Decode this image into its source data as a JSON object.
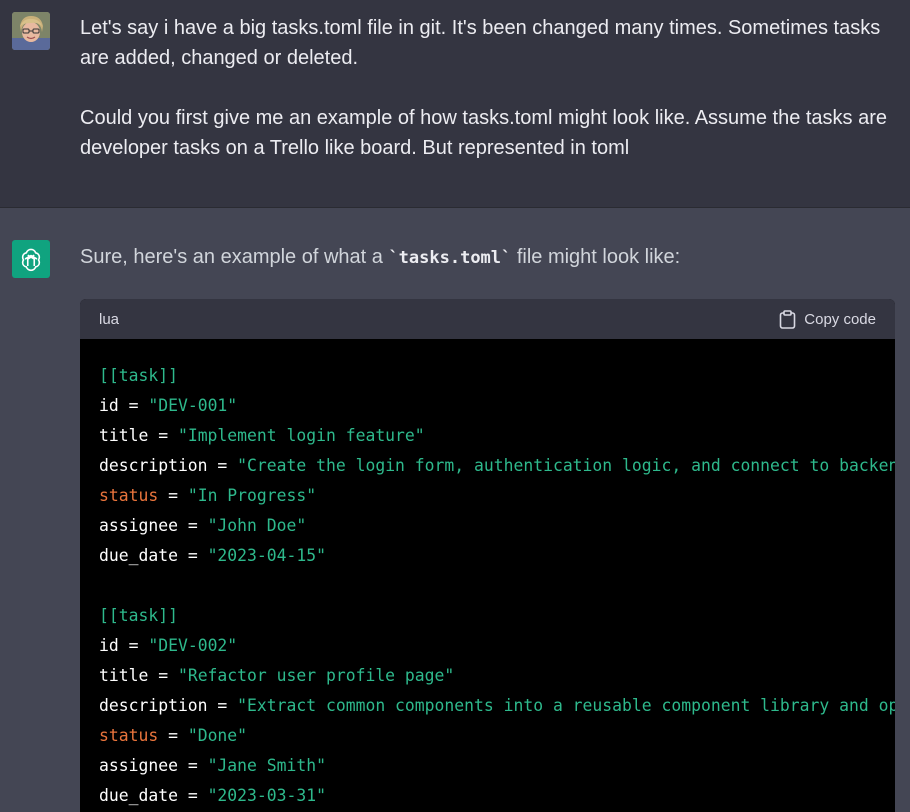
{
  "user_message": {
    "paragraph_1": "Let's say i have a big tasks.toml file in git. It's been changed many times. Sometimes tasks are added, changed or deleted.",
    "paragraph_2": "Could you first give me an example of how tasks.toml might look like. Assume the tasks are developer tasks on a Trello like board. But represented in toml"
  },
  "assistant_message": {
    "intro_before": "Sure, here's an example of what a ",
    "intro_code": "`tasks.toml`",
    "intro_after": " file might look like:"
  },
  "code_block": {
    "language": "lua",
    "copy_label": "Copy code",
    "lines": [
      {
        "type": "section",
        "text": "[[task]]"
      },
      {
        "type": "kv",
        "key": "id",
        "value": "\"DEV-001\""
      },
      {
        "type": "kv",
        "key": "title",
        "value": "\"Implement login feature\""
      },
      {
        "type": "kv",
        "key": "description",
        "value": "\"Create the login form, authentication logic, and connect to backend"
      },
      {
        "type": "kv-orange",
        "key": "status",
        "value": "\"In Progress\""
      },
      {
        "type": "kv",
        "key": "assignee",
        "value": "\"John Doe\""
      },
      {
        "type": "kv",
        "key": "due_date",
        "value": "\"2023-04-15\""
      },
      {
        "type": "blank"
      },
      {
        "type": "section",
        "text": "[[task]]"
      },
      {
        "type": "kv",
        "key": "id",
        "value": "\"DEV-002\""
      },
      {
        "type": "kv",
        "key": "title",
        "value": "\"Refactor user profile page\""
      },
      {
        "type": "kv",
        "key": "description",
        "value": "\"Extract common components into a reusable component library and opti"
      },
      {
        "type": "kv-orange",
        "key": "status",
        "value": "\"Done\""
      },
      {
        "type": "kv",
        "key": "assignee",
        "value": "\"Jane Smith\""
      },
      {
        "type": "kv",
        "key": "due_date",
        "value": "\"2023-03-31\""
      }
    ]
  },
  "icons": {
    "user_avatar": "user-avatar-photo",
    "assistant_avatar": "chatgpt-logo-icon",
    "copy": "clipboard-icon"
  },
  "colors": {
    "user_bg": "#343541",
    "assistant_bg": "#444654",
    "code_bg": "#000000",
    "code_header_bg": "#343541",
    "string": "#2eb98c",
    "orange_key": "#e9743c",
    "brand_green": "#10a37f"
  }
}
